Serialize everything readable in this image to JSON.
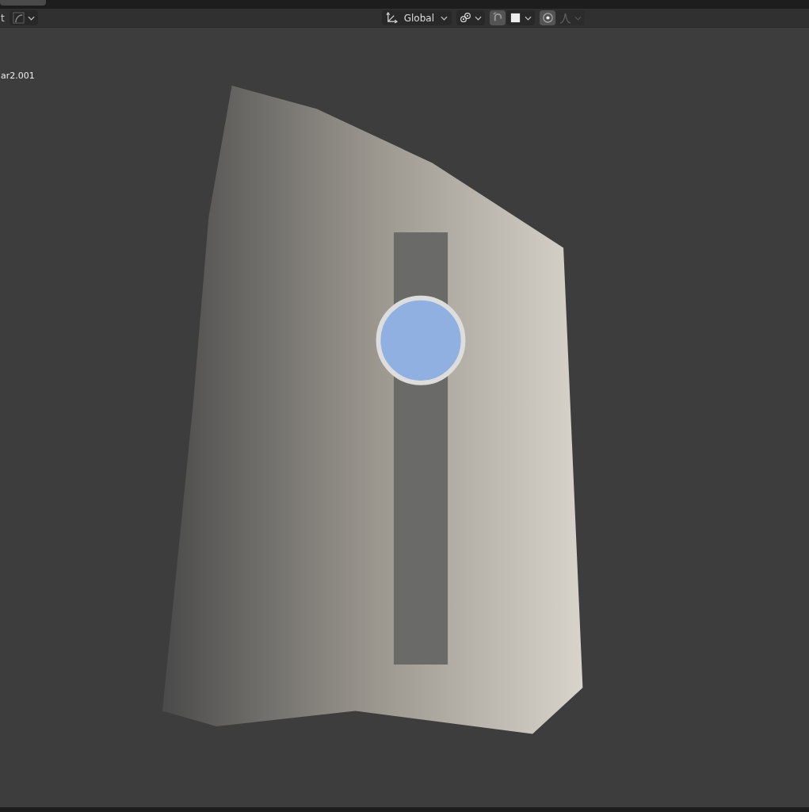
{
  "header": {
    "cut_label": "t",
    "orientation": {
      "label": "Global"
    },
    "snapping": {
      "on": true
    },
    "proportional_editing": {
      "on": true
    }
  },
  "viewport": {
    "object_name": "ar2.001"
  }
}
